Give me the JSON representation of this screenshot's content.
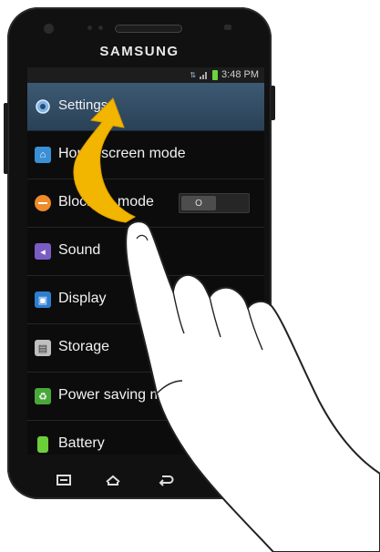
{
  "brand": "SAMSUNG",
  "status": {
    "time": "3:48 PM",
    "icons": [
      "data-icon",
      "signal-icon",
      "battery-icon"
    ]
  },
  "menu": {
    "items": [
      {
        "label": "Settings",
        "icon": "gear-icon",
        "selected": true
      },
      {
        "label": "Home screen mode",
        "icon": "home-icon"
      },
      {
        "label": "Blocking mode",
        "icon": "block-icon",
        "toggle": {
          "state": "off",
          "label": "O"
        }
      },
      {
        "label": "Sound",
        "icon": "speaker-icon"
      },
      {
        "label": "Display",
        "icon": "display-icon"
      },
      {
        "label": "Storage",
        "icon": "storage-icon"
      },
      {
        "label": "Power saving mode",
        "icon": "power-saving-icon"
      },
      {
        "label": "Battery",
        "icon": "battery-icon"
      }
    ]
  },
  "navbar": {
    "buttons": [
      "menu-icon",
      "home-icon",
      "back-icon"
    ]
  },
  "overlay": {
    "gesture": "swipe-up-arrow",
    "arrow_color": "#f2b500"
  }
}
